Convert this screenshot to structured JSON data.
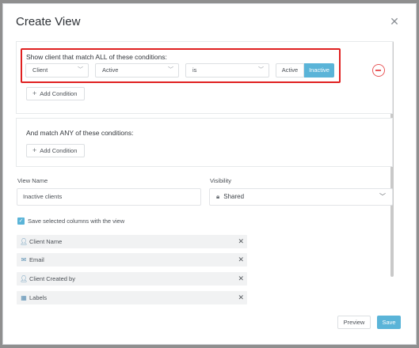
{
  "modal": {
    "title": "Create View",
    "close_icon": "close-icon"
  },
  "conditions_all": {
    "label": "Show client that match ALL of these conditions:",
    "field": "Client",
    "value": "Active",
    "operator": "is",
    "toggle_options": [
      "Active",
      "Inactive"
    ],
    "toggle_selected": "Inactive",
    "add_label": "Add Condition"
  },
  "conditions_any": {
    "label": "And match ANY of these conditions:",
    "add_label": "Add Condition"
  },
  "view_name": {
    "label": "View Name",
    "value": "Inactive clients"
  },
  "visibility": {
    "label": "Visibility",
    "value": "Shared",
    "icon": "lock-icon"
  },
  "save_columns": {
    "label": "Save selected columns with the view",
    "checked": true
  },
  "columns": [
    {
      "label": "Client Name",
      "icon": "user-icon"
    },
    {
      "label": "Email",
      "icon": "envelope-icon"
    },
    {
      "label": "Client Created by",
      "icon": "user-icon"
    },
    {
      "label": "Labels",
      "icon": "grid-icon"
    }
  ],
  "footer": {
    "preview_label": "Preview",
    "save_label": "Save"
  },
  "colors": {
    "accent": "#5ab4d8",
    "danger": "#e8585a",
    "highlight": "#e02020"
  }
}
